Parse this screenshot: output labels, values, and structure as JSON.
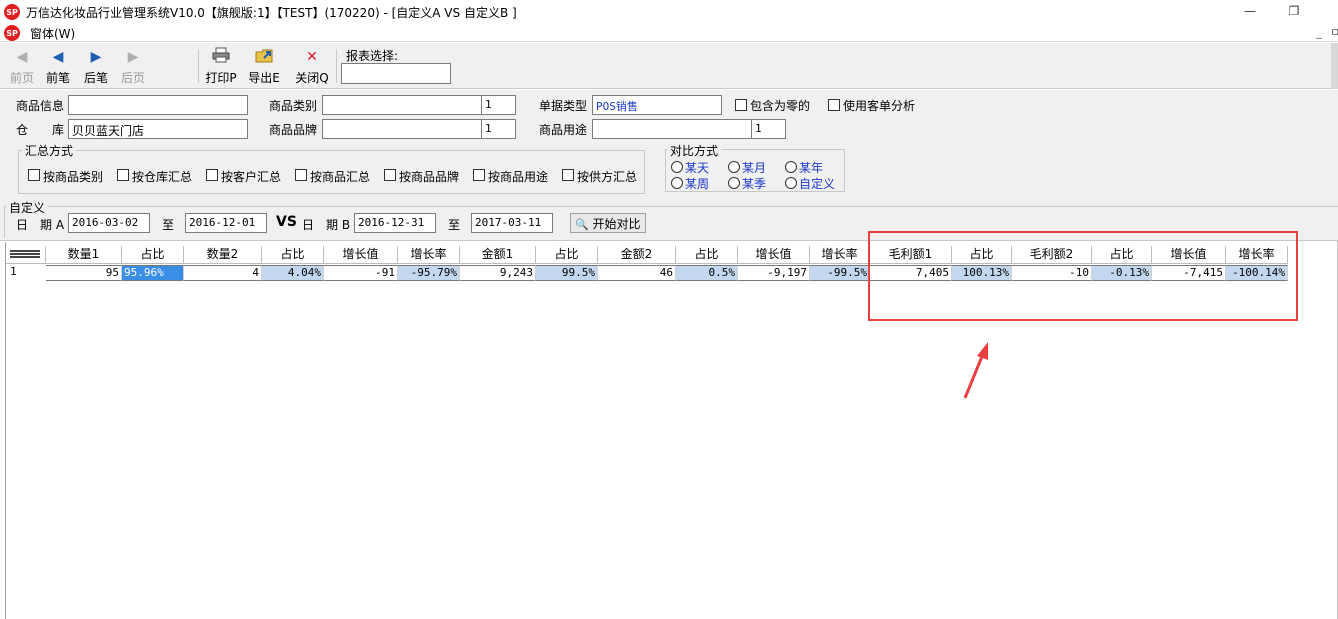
{
  "window": {
    "title": "万信达化妆品行业管理系统V10.0【旗舰版:1】【TEST】(170220) - [自定义A VS 自定义B ]",
    "logo_text": "SP",
    "buttons": {
      "minimize": "—",
      "restore": "❐"
    }
  },
  "menu": {
    "label": "窗体(W)",
    "mdi_minimize": "_",
    "mdi_restore": "ㅁ"
  },
  "toolbar": {
    "buttons": [
      {
        "label": "前页",
        "icon": "arrow-left-gray",
        "enabled": false
      },
      {
        "label": "前笔",
        "icon": "arrow-left-blue",
        "enabled": true
      },
      {
        "label": "后笔",
        "icon": "arrow-right-blue",
        "enabled": true
      },
      {
        "label": "后页",
        "icon": "arrow-right-gray",
        "enabled": false
      },
      {
        "label": "打印P",
        "icon": "printer",
        "enabled": true
      },
      {
        "label": "导出E",
        "icon": "export",
        "enabled": true
      },
      {
        "label": "关闭Q",
        "icon": "close-x",
        "enabled": true
      }
    ],
    "report_select_label": "报表选择:",
    "report_select_value": ""
  },
  "filters": {
    "product_info": {
      "label": "商品信息",
      "value": ""
    },
    "warehouse": {
      "label": "仓　　库",
      "value": "贝贝蓝天门店"
    },
    "product_category": {
      "label": "商品类别",
      "value": "",
      "count": "1"
    },
    "product_brand": {
      "label": "商品品牌",
      "value": "",
      "count": "1"
    },
    "doc_type": {
      "label": "单据类型",
      "value": "POS销售"
    },
    "product_usage": {
      "label": "商品用途",
      "value": "",
      "count": "1"
    },
    "include_zero": {
      "label": "包含为零的",
      "checked": false
    },
    "customer_analysis": {
      "label": "使用客单分析",
      "checked": false
    }
  },
  "summary_mode": {
    "title": "汇总方式",
    "options": [
      {
        "label": "按商品类别",
        "checked": false
      },
      {
        "label": "按仓库汇总",
        "checked": false
      },
      {
        "label": "按客户汇总",
        "checked": false
      },
      {
        "label": "按商品汇总",
        "checked": false
      },
      {
        "label": "按商品品牌",
        "checked": false
      },
      {
        "label": "按商品用途",
        "checked": false
      },
      {
        "label": "按供方汇总",
        "checked": false
      }
    ]
  },
  "compare_mode": {
    "title": "对比方式",
    "options": [
      {
        "label": "某天",
        "selected": false
      },
      {
        "label": "某月",
        "selected": false
      },
      {
        "label": "某年",
        "selected": false
      },
      {
        "label": "某周",
        "selected": false
      },
      {
        "label": "某季",
        "selected": false
      },
      {
        "label": "自定义",
        "selected": false
      }
    ]
  },
  "custom": {
    "title": "自定义",
    "date_a_label": "日　期 A",
    "date_a_from": "2016-03-02",
    "to_label_a": "至",
    "date_a_to": "2016-12-01",
    "vs": "VS",
    "date_b_label": "日　期 B",
    "date_b_from": "2016-12-31",
    "to_label_b": "至",
    "date_b_to": "2017-03-11",
    "start_button": "开始对比"
  },
  "grid": {
    "columns": [
      "数量1",
      "占比",
      "数量2",
      "占比",
      "增长值",
      "增长率",
      "金额1",
      "占比",
      "金额2",
      "占比",
      "增长值",
      "增长率",
      "毛利额1",
      "占比",
      "毛利额2",
      "占比",
      "增长值",
      "增长率"
    ],
    "rows": [
      {
        "row": "1",
        "cells": [
          "95",
          "95.96%",
          "4",
          "4.04%",
          "-91",
          "-95.79%",
          "9,243",
          "99.5%",
          "46",
          "0.5%",
          "-9,197",
          "-99.5%",
          "7,405",
          "100.13%",
          "-10",
          "-0.13%",
          "-7,415",
          "-100.14%"
        ]
      }
    ]
  }
}
